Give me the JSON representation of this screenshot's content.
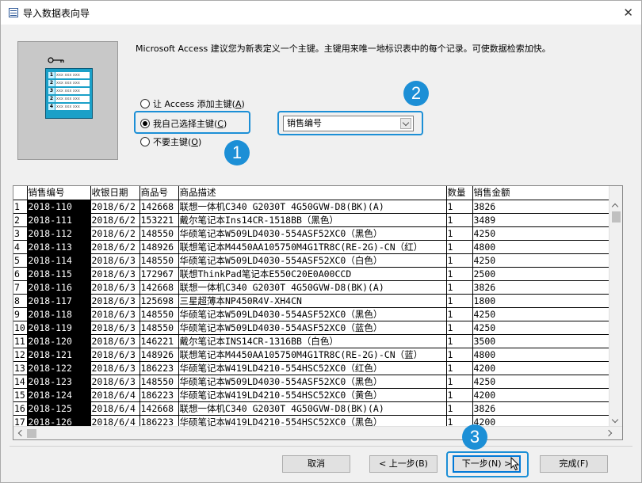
{
  "window": {
    "title": "导入数据表向导",
    "close_label": "✕"
  },
  "preview": {
    "rows": [
      {
        "num": "1",
        "cell": "xxx xxx xxx"
      },
      {
        "num": "2",
        "cell": "xxx xxx xxx"
      },
      {
        "num": "3",
        "cell": "xxx xxx xxx"
      },
      {
        "num": "2",
        "cell": "xxx xxx xxx"
      },
      {
        "num": "4",
        "cell": "xxx xxx xxx"
      }
    ]
  },
  "description": "Microsoft Access 建议您为新表定义一个主键。主键用来唯一地标识表中的每个记录。可使数据检索加快。",
  "radios": [
    {
      "label": "让 Access 添加主键",
      "accel": "A",
      "checked": false
    },
    {
      "label": "我自己选择主键",
      "accel": "C",
      "checked": true
    },
    {
      "label": "不要主键",
      "accel": "O",
      "checked": false
    }
  ],
  "primary_key_select": {
    "value": "销售编号"
  },
  "callouts": [
    "1",
    "2",
    "3"
  ],
  "grid": {
    "columns": [
      "销售编号",
      "收银日期",
      "商品号",
      "商品描述",
      "数量",
      "销售金额"
    ],
    "rows": [
      [
        "1",
        "2018-110",
        "2018/6/2",
        "142668",
        "联想一体机C340 G2030T 4G50GVW-D8(BK)(A)",
        "1",
        "3826"
      ],
      [
        "2",
        "2018-111",
        "2018/6/2",
        "153221",
        "戴尔笔记本Ins14CR-1518BB（黑色）",
        "1",
        "3489"
      ],
      [
        "3",
        "2018-112",
        "2018/6/2",
        "148550",
        "华硕笔记本W509LD4030-554ASF52XC0（黑色）",
        "1",
        "4250"
      ],
      [
        "4",
        "2018-113",
        "2018/6/2",
        "148926",
        "联想笔记本M4450AA105750M4G1TR8C(RE-2G)-CN（红）",
        "1",
        "4800"
      ],
      [
        "5",
        "2018-114",
        "2018/6/3",
        "148550",
        "华硕笔记本W509LD4030-554ASF52XC0（白色）",
        "1",
        "4250"
      ],
      [
        "6",
        "2018-115",
        "2018/6/3",
        "172967",
        "联想ThinkPad笔记本E550C20E0A00CCD",
        "1",
        "2500"
      ],
      [
        "7",
        "2018-116",
        "2018/6/3",
        "142668",
        "联想一体机C340 G2030T 4G50GVW-D8(BK)(A)",
        "1",
        "3826"
      ],
      [
        "8",
        "2018-117",
        "2018/6/3",
        "125698",
        "三星超薄本NP450R4V-XH4CN",
        "1",
        "1800"
      ],
      [
        "9",
        "2018-118",
        "2018/6/3",
        "148550",
        "华硕笔记本W509LD4030-554ASF52XC0（黑色）",
        "1",
        "4250"
      ],
      [
        "10",
        "2018-119",
        "2018/6/3",
        "148550",
        "华硕笔记本W509LD4030-554ASF52XC0（蓝色）",
        "1",
        "4250"
      ],
      [
        "11",
        "2018-120",
        "2018/6/3",
        "146221",
        "戴尔笔记本INS14CR-1316BB（白色）",
        "1",
        "3500"
      ],
      [
        "12",
        "2018-121",
        "2018/6/3",
        "148926",
        "联想笔记本M4450AA105750M4G1TR8C(RE-2G)-CN（蓝）",
        "1",
        "4800"
      ],
      [
        "13",
        "2018-122",
        "2018/6/3",
        "186223",
        "华硕笔记本W419LD4210-554HSC52XC0（红色）",
        "1",
        "4200"
      ],
      [
        "14",
        "2018-123",
        "2018/6/3",
        "148550",
        "华硕笔记本W509LD4030-554ASF52XC0（黑色）",
        "1",
        "4250"
      ],
      [
        "15",
        "2018-124",
        "2018/6/4",
        "186223",
        "华硕笔记本W419LD4210-554HSC52XC0（黄色）",
        "1",
        "4200"
      ],
      [
        "16",
        "2018-125",
        "2018/6/4",
        "142668",
        "联想一体机C340 G2030T 4G50GVW-D8(BK)(A)",
        "1",
        "3826"
      ],
      [
        "17",
        "2018-126",
        "2018/6/4",
        "186223",
        "华硕笔记本W419LD4210-554HSC52XC0（黑色）",
        "1",
        "4200"
      ]
    ]
  },
  "buttons": {
    "cancel": "取消",
    "back": "< 上一步(B)",
    "next": "下一步(N) >",
    "finish": "完成(F)"
  },
  "colors": {
    "highlight": "#1c8fd6",
    "selected_column_bg": "#000000"
  }
}
